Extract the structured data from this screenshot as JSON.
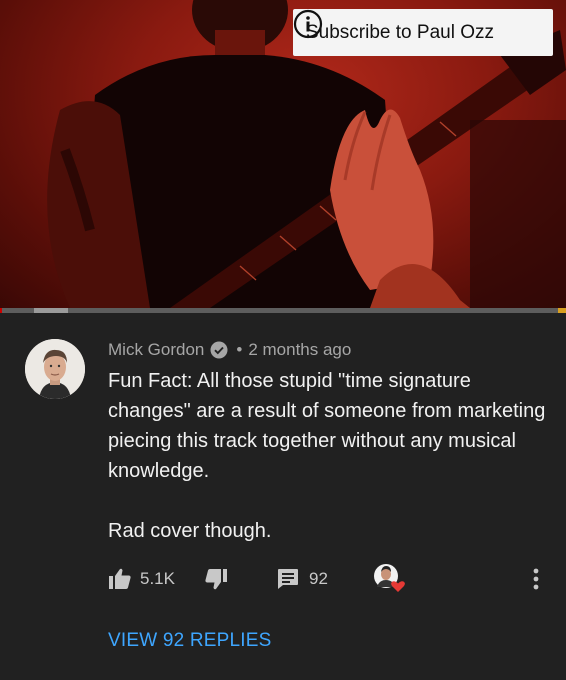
{
  "video": {
    "subscribe_label": "Subscribe to Paul Ozz",
    "progress": {
      "played_fraction": 0.003,
      "buffered_start": 0.06,
      "buffered_end": 0.12
    }
  },
  "comment": {
    "author": "Mick Gordon",
    "verified": true,
    "time": "2 months ago",
    "body": [
      "Fun Fact: All those stupid \"time signature changes\" are a result of someone from marketing piecing this track together without any musical knowledge.",
      "Rad cover though."
    ],
    "likes": "5.1K",
    "replies_count": "92",
    "view_replies_label": "VIEW 92 REPLIES"
  },
  "colors": {
    "background": "#212121",
    "link": "#3ea6ff",
    "progress_played": "#cc0000",
    "heart": "#e53935"
  },
  "icons": {
    "verified": "check-circle-icon",
    "like": "thumbs-up-icon",
    "dislike": "thumbs-down-icon",
    "reply": "comment-icon",
    "hearted": "creator-heart-badge",
    "more": "more-vert-icon",
    "info": "info-icon"
  }
}
